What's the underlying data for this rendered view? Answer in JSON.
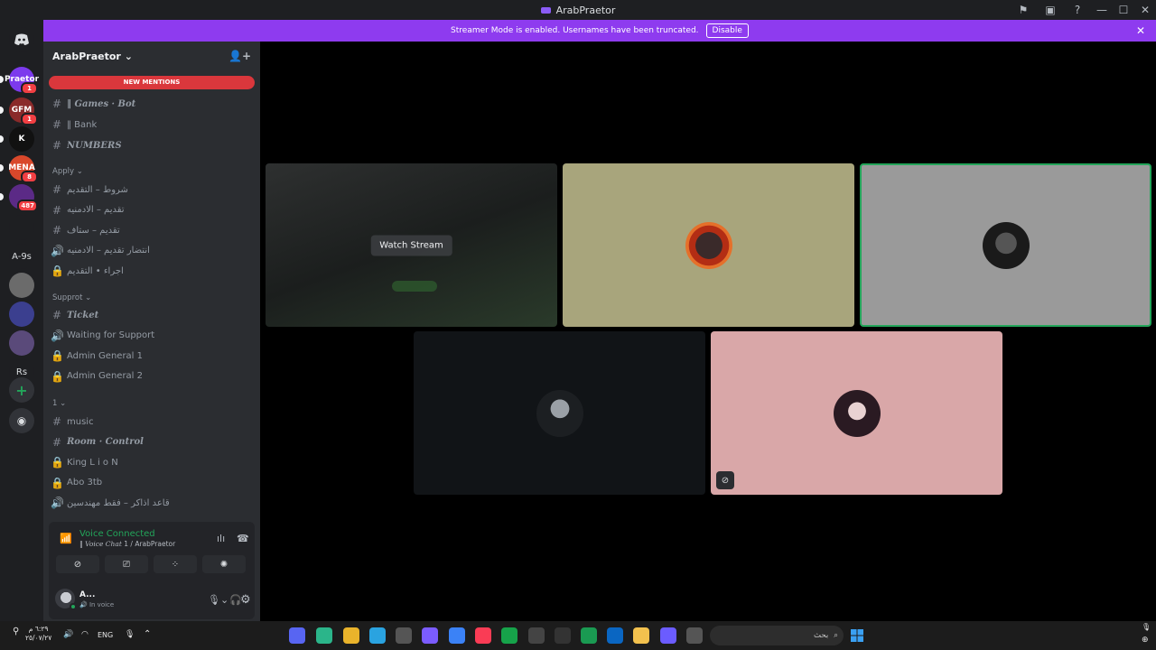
{
  "window": {
    "title": "ArabPraetor"
  },
  "banner": {
    "text": "Streamer Mode is enabled. Usernames have been truncated.",
    "button": "Disable"
  },
  "servers": [
    {
      "label": "Praetor",
      "badge": "1",
      "color": "#7c3aed"
    },
    {
      "label": "GFM",
      "badge": "1",
      "color": "#8a2a2a"
    },
    {
      "label": "K",
      "badge": "",
      "color": "#111111"
    },
    {
      "label": "MENA",
      "badge": "8",
      "color": "#d9482b"
    },
    {
      "label": "",
      "badge": "487",
      "color": "#5b2a86"
    },
    {
      "label": "",
      "badge": "",
      "color": "#1e1f22"
    },
    {
      "label": "A-9s",
      "badge": "",
      "color": "#1e1f22"
    },
    {
      "label": "",
      "badge": "",
      "color": "#6b6b6b"
    },
    {
      "label": "",
      "badge": "",
      "color": "#3b3f8f"
    },
    {
      "label": "",
      "badge": "",
      "color": "#5a4a7a"
    },
    {
      "label": "Rs",
      "badge": "",
      "color": "#1e1f22"
    }
  ],
  "sidebar": {
    "guild_name": "ArabPraetor",
    "new_mentions": "NEW MENTIONS",
    "channels_top": [
      {
        "sym": "#",
        "name": "Games · Bot",
        "prefix": "‖",
        "italic": true
      },
      {
        "sym": "#",
        "name": "Bank",
        "prefix": "‖",
        "italic": false
      },
      {
        "sym": "#",
        "name": "NUMBERS",
        "prefix": "",
        "italic": true
      }
    ],
    "cat_apply": "Apply",
    "channels_apply": [
      {
        "sym": "#",
        "name": "شروط – التقديم"
      },
      {
        "sym": "#",
        "name": "تقديم – الادمنيه"
      },
      {
        "sym": "#",
        "name": "تقديم – ستاف"
      },
      {
        "sym": "🔊",
        "name": "انتضار تقديم – الادمنيه"
      },
      {
        "sym": "🔒",
        "name": "اجراء • التقديم"
      }
    ],
    "cat_support": "Supprot",
    "channels_support": [
      {
        "sym": "#",
        "name": "Ticket",
        "italic": true
      },
      {
        "sym": "🔊",
        "name": "Waiting for Support"
      },
      {
        "sym": "🔒",
        "name": "Admin General 1"
      },
      {
        "sym": "🔒",
        "name": "Admin General 2"
      }
    ],
    "cat_1": "1",
    "channels_1": [
      {
        "sym": "#",
        "name": "music"
      },
      {
        "sym": "#",
        "name": "Room · Control",
        "italic": true
      },
      {
        "sym": "🔒",
        "name": "King L i o N"
      },
      {
        "sym": "🔒",
        "name": "Abo 3tb"
      },
      {
        "sym": "🔊",
        "name": "قاعد اذاكر – فقط مهندسين"
      }
    ]
  },
  "voice": {
    "status": "Voice Connected",
    "channel": "Voice Chat",
    "path": "1 / ArabPraetor",
    "user_short": "A...",
    "user_status": "In voice"
  },
  "stage": {
    "watch_stream": "Watch Stream"
  },
  "taskbar": {
    "time": "٦:٢٩ م",
    "date": "٢٥/٠٧/٢٧",
    "lang": "ENG",
    "search_placeholder": "بحث"
  }
}
